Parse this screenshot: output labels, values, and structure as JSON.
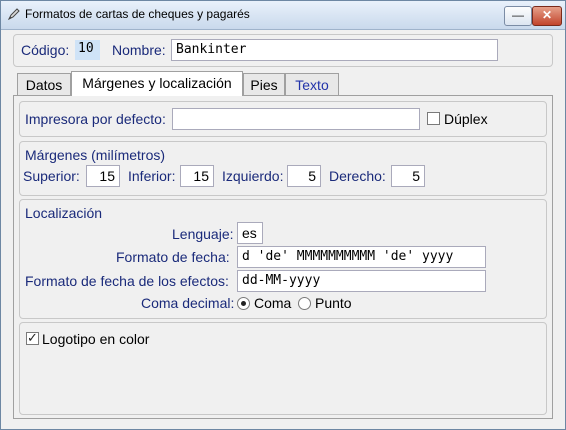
{
  "window": {
    "title": "Formatos de cartas de cheques y pagarés",
    "minimize_glyph": "—",
    "close_glyph": "✕"
  },
  "header": {
    "codigo_label": "Código:",
    "codigo_value": "10",
    "nombre_label": "Nombre:",
    "nombre_value": "Bankinter"
  },
  "tabs": [
    "Datos",
    "Márgenes y localización",
    "Pies",
    "Texto"
  ],
  "impresora": {
    "label": "Impresora por defecto:",
    "value": "",
    "duplex_label": "Dúplex",
    "duplex_checked": false
  },
  "margenes": {
    "title": "Márgenes (milímetros)",
    "superior_label": "Superior:",
    "superior": "15",
    "inferior_label": "Inferior:",
    "inferior": "15",
    "izquierdo_label": "Izquierdo:",
    "izquierdo": "5",
    "derecho_label": "Derecho:",
    "derecho": "5"
  },
  "localizacion": {
    "title": "Localización",
    "lenguaje_label": "Lenguaje:",
    "lenguaje": "es",
    "formato_fecha_label": "Formato de fecha:",
    "formato_fecha": "d 'de' MMMMMMMMMM 'de' yyyy",
    "formato_efectos_label": "Formato de fecha de los efectos:",
    "formato_efectos": "dd-MM-yyyy",
    "coma_decimal_label": "Coma decimal:",
    "coma_label": "Coma",
    "punto_label": "Punto",
    "selected": "Coma"
  },
  "logotipo": {
    "label": "Logotipo en color",
    "checked": true
  }
}
